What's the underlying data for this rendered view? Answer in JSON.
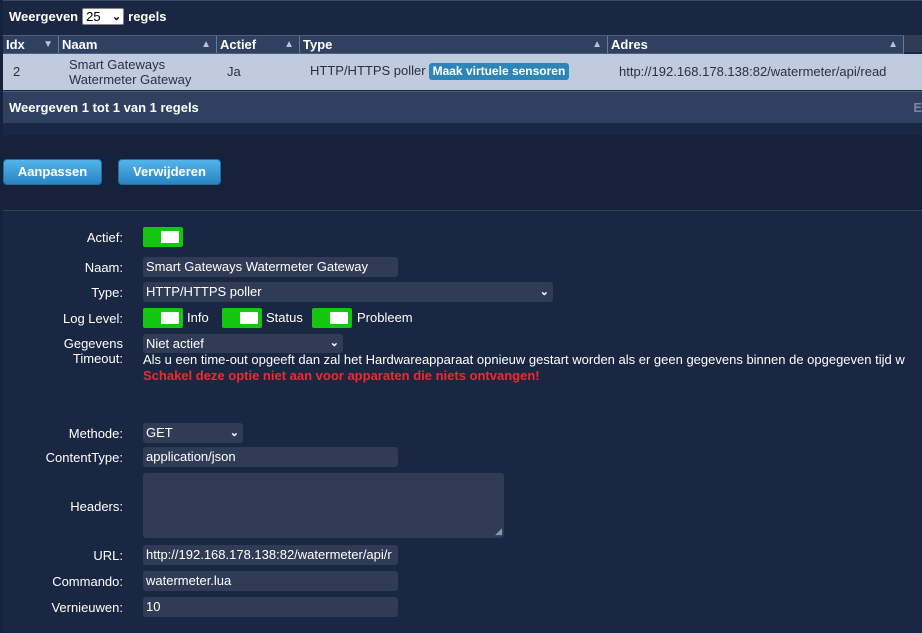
{
  "table": {
    "length": {
      "prefix": "Weergeven",
      "value": "25",
      "suffix": "regels"
    },
    "columns": [
      {
        "label": "Idx",
        "sort": "▼"
      },
      {
        "label": "Naam",
        "sort": "▲"
      },
      {
        "label": "Actief",
        "sort": "▲"
      },
      {
        "label": "Type",
        "sort": "▲"
      },
      {
        "label": "Adres",
        "sort": "▲"
      }
    ],
    "row": {
      "idx": "2",
      "name_line1": "Smart Gateways",
      "name_line2": "Watermeter Gateway",
      "active": "Ja",
      "type": "HTTP/HTTPS poller",
      "virtual_button": "Maak virtuele sensoren",
      "address": "http://192.168.178.138:82/watermeter/api/read"
    },
    "info": "Weergeven 1 tot 1 van 1 regels",
    "pager_fragment": "E"
  },
  "actions": {
    "update": "Aanpassen",
    "delete": "Verwijderen"
  },
  "form": {
    "active_label": "Actief:",
    "name_label": "Naam:",
    "name_value": "Smart Gateways Watermeter Gateway",
    "type_label": "Type:",
    "type_value": "HTTP/HTTPS poller",
    "loglevel_label": "Log Level:",
    "loglevel_info": "Info",
    "loglevel_status": "Status",
    "loglevel_error": "Probleem",
    "timeout_label_1": "Gegevens",
    "timeout_label_2": "Timeout:",
    "timeout_value": "Niet actief",
    "timeout_help": "Als u een time-out opgeeft dan zal het Hardwareapparaat opnieuw gestart worden als er geen gegevens binnen de opgegeven tijd w",
    "timeout_warning": "Schakel deze optie niet aan voor apparaten die niets ontvangen!",
    "method_label": "Methode:",
    "method_value": "GET",
    "contenttype_label": "ContentType:",
    "contenttype_value": "application/json",
    "headers_label": "Headers:",
    "url_label": "URL:",
    "url_value": "http://192.168.178.138:82/watermeter/api/r",
    "command_label": "Commando:",
    "command_value": "watermeter.lua",
    "refresh_label": "Vernieuwen:",
    "refresh_value": "10"
  },
  "colors": {
    "page_bg": "#16223b",
    "panel_bg": "#1a2742",
    "header_bg": "#304060",
    "row_selected_bg": "#c0cbe0",
    "accent_button": "#2a84c2",
    "toggle_on": "#13c70f",
    "warning": "#ee2b2b"
  },
  "icons": {
    "select_arrow": "chevron-down-icon",
    "sort_desc": "sort-desc-icon",
    "sort_asc": "sort-asc-icon",
    "resize": "resize-grip-icon"
  }
}
